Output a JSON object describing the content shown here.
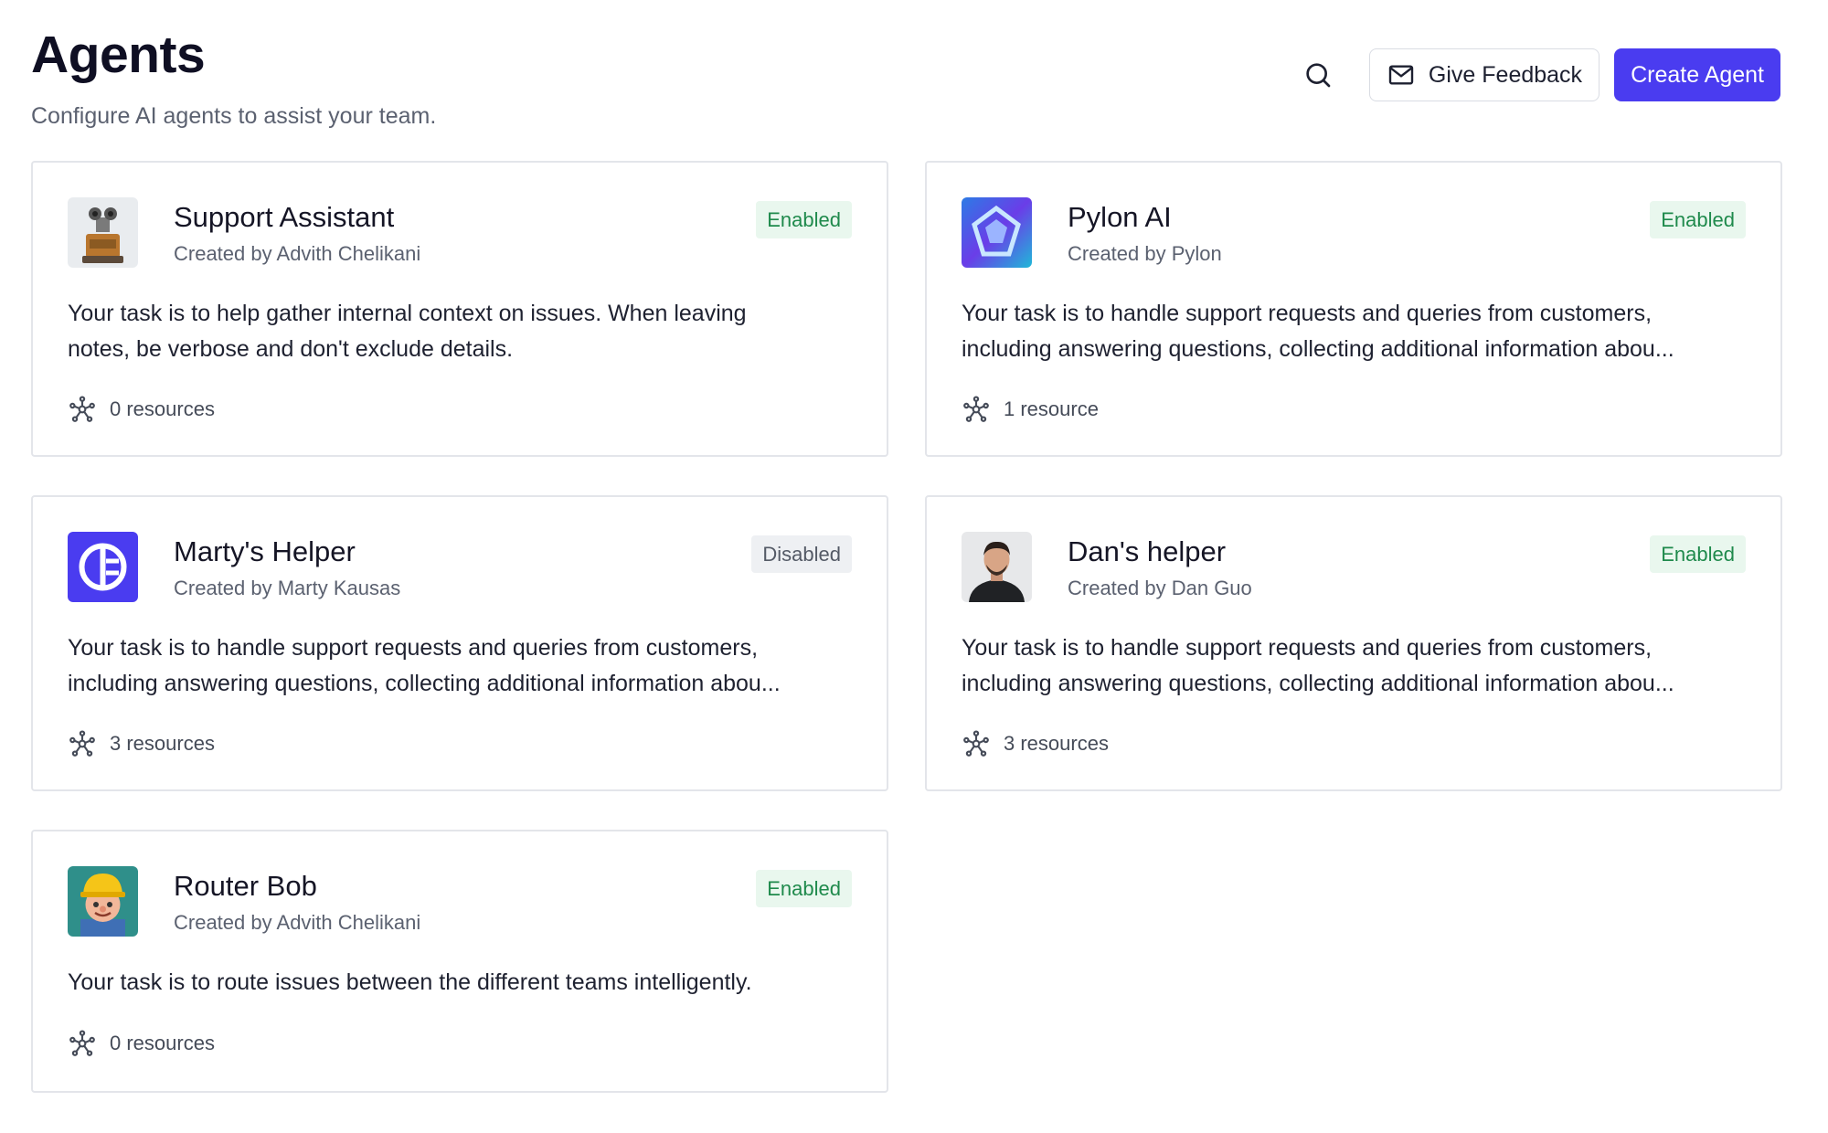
{
  "header": {
    "title": "Agents",
    "subtitle": "Configure AI agents to assist your team.",
    "give_feedback_label": "Give Feedback",
    "create_agent_label": "Create Agent"
  },
  "colors": {
    "primary": "#4a3cf0",
    "enabled_bg": "#e9f7ee",
    "enabled_text": "#1f8a4c",
    "disabled_bg": "#eef0f3"
  },
  "agents": [
    {
      "name": "Support Assistant",
      "creator": "Created by Advith Chelikani",
      "status": "Enabled",
      "description_line1": "Your task is to help gather internal context on issues. When leaving",
      "description_line2": "notes, be verbose and don't exclude details.",
      "resources": "0 resources",
      "avatar_icon": "robot-avatar-icon"
    },
    {
      "name": "Pylon AI",
      "creator": "Created by Pylon",
      "status": "Enabled",
      "description_line1": "Your task is to handle support requests and queries from customers,",
      "description_line2": "including answering questions, collecting additional information abou...",
      "resources": "1 resource",
      "avatar_icon": "pylon-logo-icon"
    },
    {
      "name": "Marty's Helper",
      "creator": "Created by Marty Kausas",
      "status": "Disabled",
      "description_line1": "Your task is to handle support requests and queries from customers,",
      "description_line2": "including answering questions, collecting additional information abou...",
      "resources": "3 resources",
      "avatar_icon": "helper-logo-icon"
    },
    {
      "name": "Dan's helper",
      "creator": "Created by Dan Guo",
      "status": "Enabled",
      "description_line1": "Your task is to handle support requests and queries from customers,",
      "description_line2": "including answering questions, collecting additional information abou...",
      "resources": "3 resources",
      "avatar_icon": "person-photo-icon"
    },
    {
      "name": "Router Bob",
      "creator": "Created by Advith Chelikani",
      "status": "Enabled",
      "description_line1": "Your task is to route issues between the different teams intelligently.",
      "description_line2": "",
      "resources": "0 resources",
      "avatar_icon": "builder-avatar-icon"
    }
  ]
}
